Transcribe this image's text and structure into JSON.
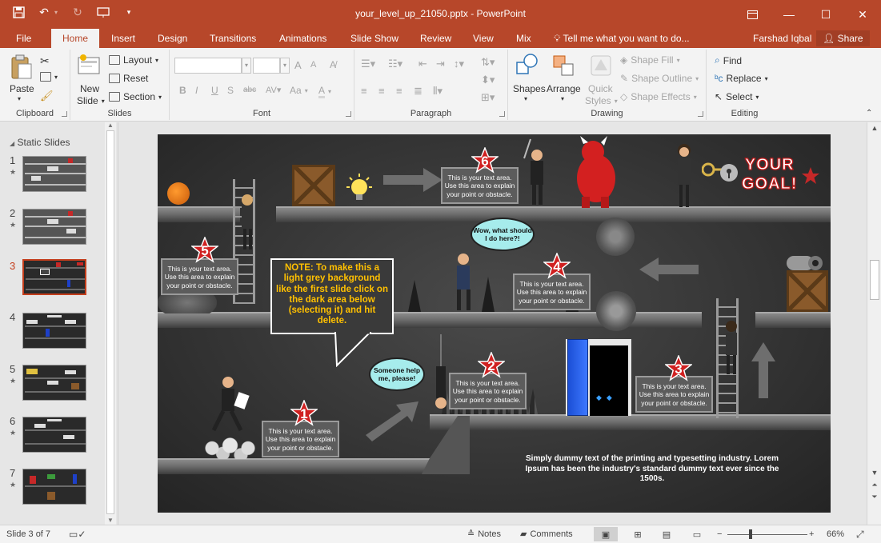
{
  "window": {
    "title": "your_level_up_21050.pptx - PowerPoint",
    "qat_icons": [
      "save-icon",
      "undo-icon",
      "redo-icon",
      "present-icon",
      "customize-icon"
    ]
  },
  "tabs": [
    "File",
    "Home",
    "Insert",
    "Design",
    "Transitions",
    "Animations",
    "Slide Show",
    "Review",
    "View",
    "Mix"
  ],
  "active_tab": "Home",
  "tell_me": "Tell me what you want to do...",
  "user_name": "Farshad Iqbal",
  "share_label": "Share",
  "ribbon": {
    "clipboard": {
      "label": "Clipboard",
      "paste": "Paste"
    },
    "slides": {
      "label": "Slides",
      "new_slide_1": "New",
      "new_slide_2": "Slide",
      "layout": "Layout",
      "reset": "Reset",
      "section": "Section"
    },
    "font": {
      "label": "Font",
      "bold": "B",
      "italic": "I",
      "underline": "U",
      "strike": "S",
      "spacing": "abc",
      "case": "Aa",
      "grow": "A",
      "shrink": "A"
    },
    "paragraph": {
      "label": "Paragraph"
    },
    "drawing": {
      "label": "Drawing",
      "shapes": "Shapes",
      "arrange": "Arrange",
      "quick_styles_1": "Quick",
      "quick_styles_2": "Styles",
      "shape_fill": "Shape Fill",
      "shape_outline": "Shape Outline",
      "shape_effects": "Shape Effects"
    },
    "editing": {
      "label": "Editing",
      "find": "Find",
      "replace": "Replace",
      "select": "Select"
    }
  },
  "thumbnails": {
    "section_title": "Static Slides",
    "items": [
      {
        "num": "1",
        "star": "★"
      },
      {
        "num": "2",
        "star": "★"
      },
      {
        "num": "3",
        "star": ""
      },
      {
        "num": "4",
        "star": ""
      },
      {
        "num": "5",
        "star": "★"
      },
      {
        "num": "6",
        "star": "★"
      },
      {
        "num": "7",
        "star": "★"
      }
    ],
    "active_index": 3
  },
  "slide": {
    "goal_line1": "YOUR",
    "goal_line2": "GOAL!",
    "note": "NOTE: To make this a light grey background like the first slide click on the dark area below (selecting it) and hit delete.",
    "bubble_wow": "Wow, what should I do here?!",
    "bubble_help": "Someone help me, please!",
    "textbox_text": "This is your text area. Use this area to explain your point or obstacle.",
    "numbers": [
      "1",
      "2",
      "3",
      "4",
      "5",
      "6"
    ],
    "lorem": "Simply dummy text of the printing and typesetting industry. Lorem Ipsum has been the industry's standard dummy text ever since the 1500s."
  },
  "status": {
    "slide_info": "Slide 3 of 7",
    "notes": "Notes",
    "comments": "Comments",
    "zoom": "66%"
  }
}
